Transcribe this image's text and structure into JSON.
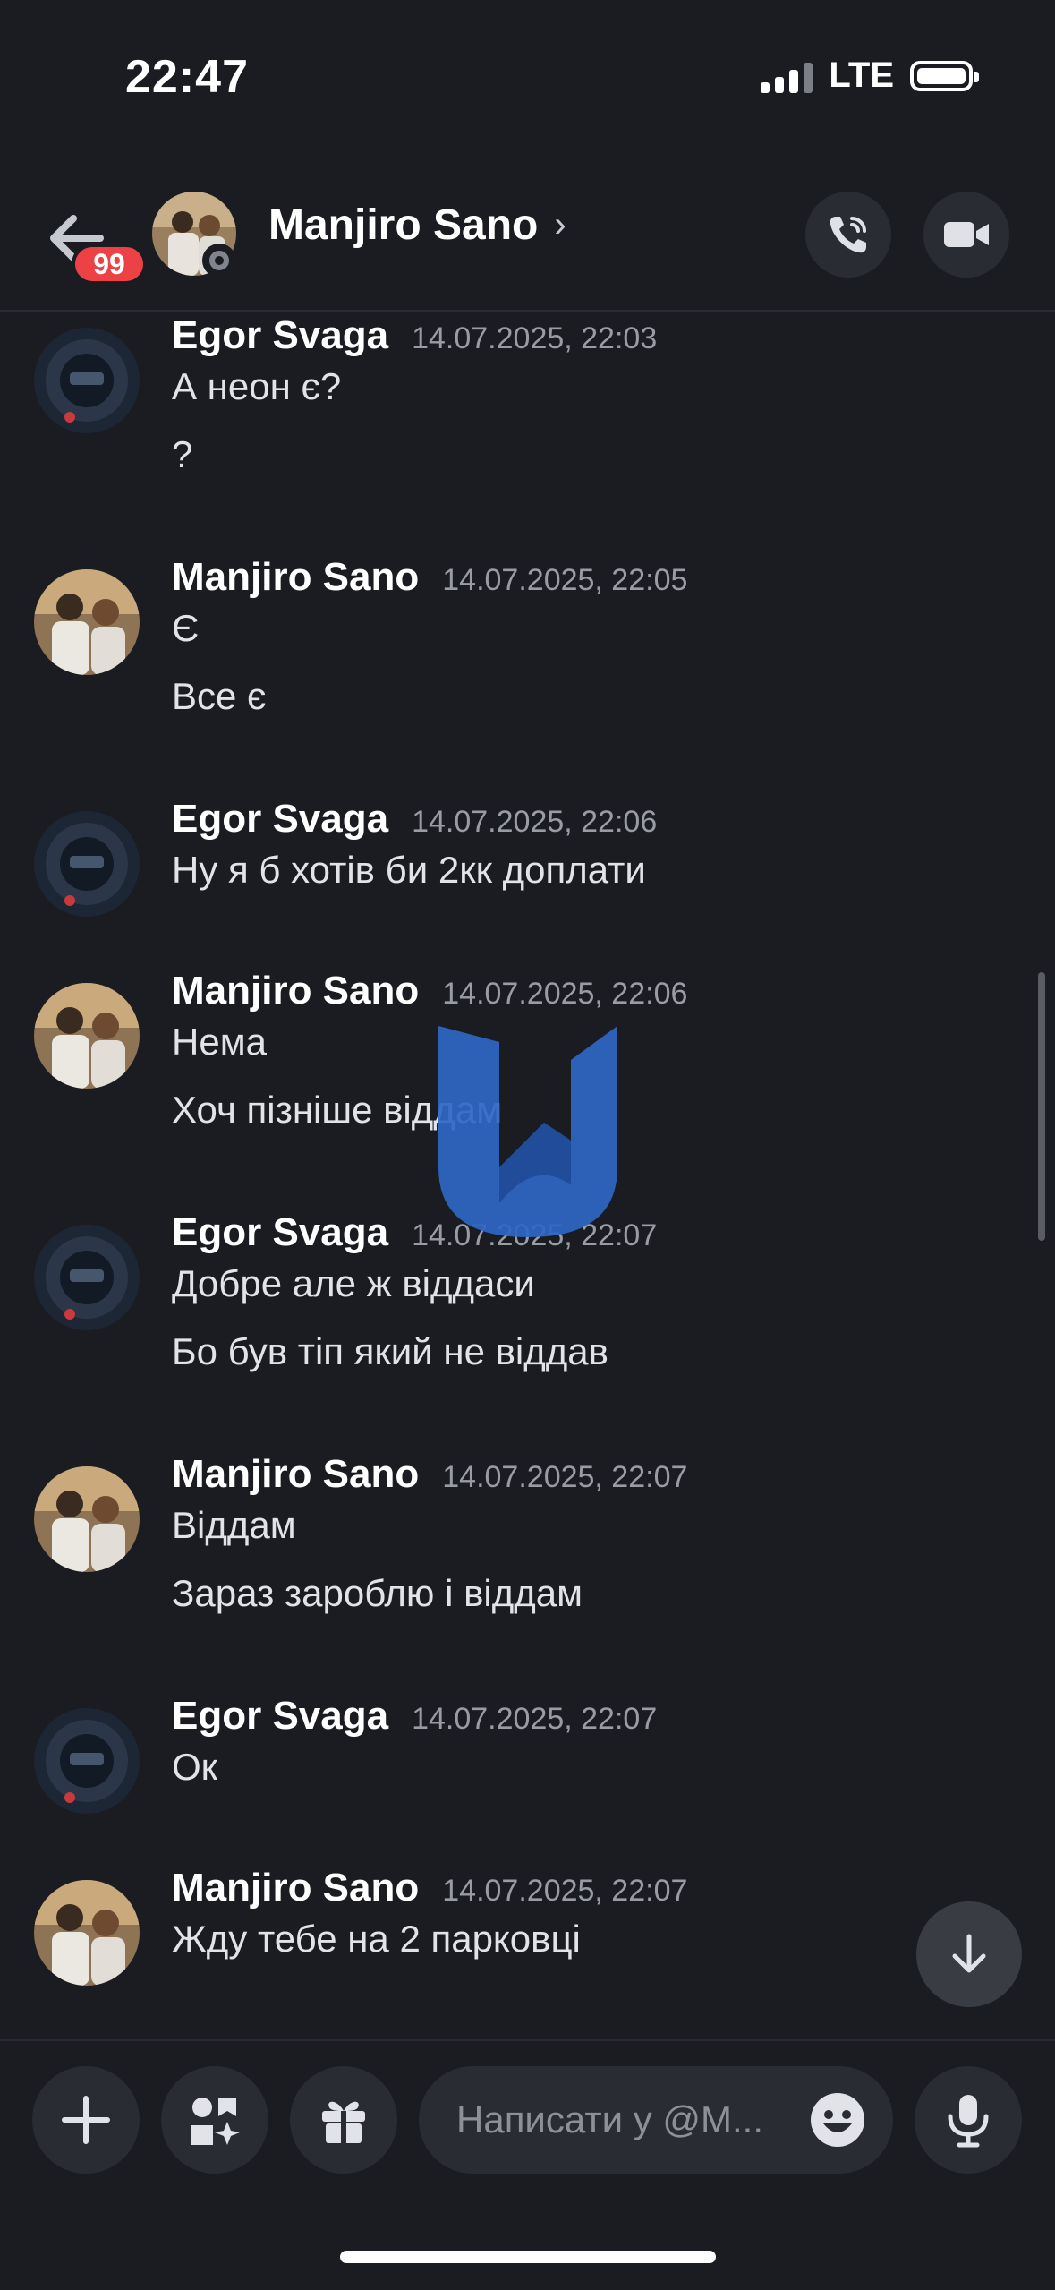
{
  "status_bar": {
    "time": "22:47",
    "network": "LTE"
  },
  "header": {
    "unread_badge": "99",
    "contact_name": "Manjiro Sano",
    "chevron": "›"
  },
  "messages": [
    {
      "author": "Egor Svaga",
      "timestamp": "14.07.2025, 22:03",
      "lines": [
        "А неон є?",
        "?"
      ]
    },
    {
      "author": "Manjiro Sano",
      "timestamp": "14.07.2025, 22:05",
      "lines": [
        "Є",
        "Все є"
      ]
    },
    {
      "author": "Egor Svaga",
      "timestamp": "14.07.2025, 22:06",
      "lines": [
        "Ну я б хотів би 2кк доплати"
      ]
    },
    {
      "author": "Manjiro Sano",
      "timestamp": "14.07.2025, 22:06",
      "lines": [
        "Нема",
        "Хоч пізніше віддам"
      ]
    },
    {
      "author": "Egor Svaga",
      "timestamp": "14.07.2025, 22:07",
      "lines": [
        "Добре але ж віддаси",
        "Бо був тіп який не віддав"
      ]
    },
    {
      "author": "Manjiro Sano",
      "timestamp": "14.07.2025, 22:07",
      "lines": [
        "Віддам",
        "Зараз зароблю і віддам"
      ]
    },
    {
      "author": "Egor Svaga",
      "timestamp": "14.07.2025, 22:07",
      "lines": [
        "Ок"
      ]
    },
    {
      "author": "Manjiro Sano",
      "timestamp": "14.07.2025, 22:07",
      "lines": [
        "Жду тебе на 2 парковці"
      ]
    }
  ],
  "composer": {
    "placeholder": "Написати у @M..."
  },
  "colors": {
    "background": "#1b1c21",
    "badge": "#ed4245",
    "button_bg": "#2a2c33",
    "watermark": "#2f66c4"
  }
}
